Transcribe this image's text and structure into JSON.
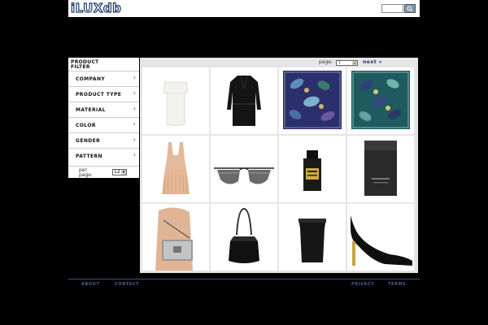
{
  "header": {
    "logo_text": "iLUXdb",
    "search_placeholder": ""
  },
  "sidebar": {
    "title_line1": "PRODUCT",
    "title_line2": "FILTER",
    "items": [
      {
        "label": "COMPANY"
      },
      {
        "label": "PRODUCT TYPE"
      },
      {
        "label": "MATERIAL"
      },
      {
        "label": "COLOR"
      },
      {
        "label": "GENDER"
      },
      {
        "label": "PATTERN"
      }
    ],
    "per_page_label_1": "per",
    "per_page_label_2": "page:",
    "per_page_value": "12"
  },
  "pagination": {
    "page_label": "page:",
    "page_value": "1",
    "next_label": "next »"
  },
  "products": [
    {
      "icon": "white-skirt"
    },
    {
      "icon": "black-coat"
    },
    {
      "icon": "paisley-scarf-navy"
    },
    {
      "icon": "paisley-scarf-teal"
    },
    {
      "icon": "fringe-top"
    },
    {
      "icon": "aviator-sunglasses"
    },
    {
      "icon": "perfume-bottle-gold"
    },
    {
      "icon": "cologne-bottle-black"
    },
    {
      "icon": "silver-clutch"
    },
    {
      "icon": "black-bucket-bag"
    },
    {
      "icon": "black-pencil-skirt"
    },
    {
      "icon": "black-stiletto-heel"
    }
  ],
  "footer": {
    "links": [
      "ABOUT",
      "CONTACT",
      "PRIVACY",
      "TERMS"
    ]
  },
  "colors": {
    "background": "#000000",
    "grid": "#e6e6e6",
    "accent": "#1b2f5e",
    "footer_link": "#4d5fa0"
  }
}
